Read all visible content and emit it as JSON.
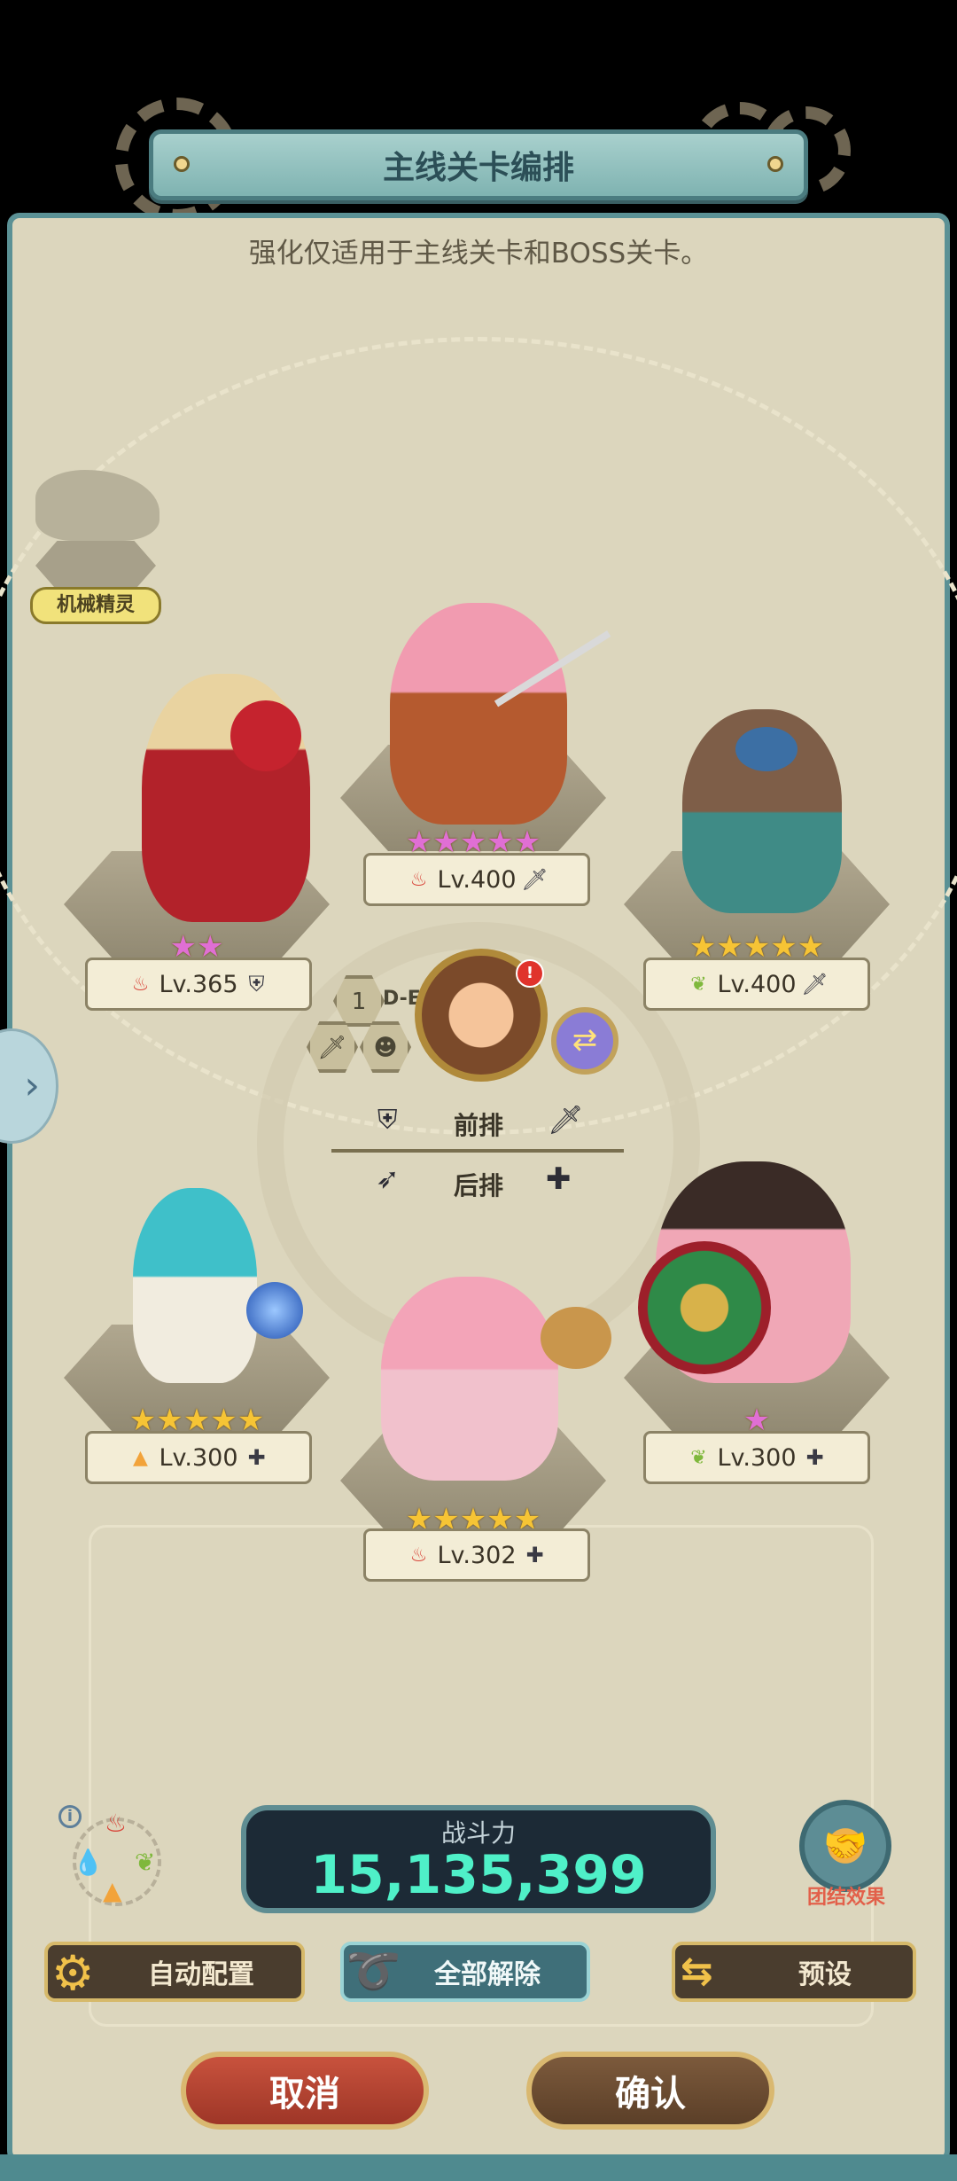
{
  "header": {
    "title": "主线关卡编排",
    "subtitle": "强化仅适用于主线关卡和BOSS关卡。"
  },
  "pet": {
    "label": "机械精灵"
  },
  "heroes": [
    {
      "slot": "front-left",
      "level": "Lv.365",
      "element": "fire",
      "role": "shield-icon",
      "stars": 2,
      "star_color": "pink"
    },
    {
      "slot": "front-center",
      "level": "Lv.400",
      "element": "fire",
      "role": "sword-icon",
      "stars": 5,
      "star_color": "pink"
    },
    {
      "slot": "front-right",
      "level": "Lv.400",
      "element": "wind",
      "role": "sword-icon",
      "stars": 5,
      "star_color": "gold"
    },
    {
      "slot": "back-left",
      "level": "Lv.300",
      "element": "earth",
      "role": "plus-icon",
      "stars": 5,
      "star_color": "gold"
    },
    {
      "slot": "back-center",
      "level": "Lv.302",
      "element": "fire",
      "role": "plus-icon",
      "stars": 5,
      "star_color": "gold"
    },
    {
      "slot": "back-right",
      "level": "Lv.300",
      "element": "wind",
      "role": "plus-icon",
      "stars": 1,
      "star_color": "pink"
    }
  ],
  "formation": {
    "leader_number": "1",
    "leader_tag": "D-E",
    "front_label": "前排",
    "back_label": "后排"
  },
  "power": {
    "label": "战斗力",
    "value": "15,135,399"
  },
  "team_effect": {
    "label": "团结效果"
  },
  "buttons": {
    "auto": "自动配置",
    "clear": "全部解除",
    "preset": "预设",
    "cancel": "取消",
    "confirm": "确认"
  },
  "colors": {
    "fire": "#d8453a",
    "wind": "#7fb83c",
    "earth": "#f2a33a",
    "water": "#3f7ad0",
    "accent_teal": "#5b9195",
    "power_green": "#4ff0c8"
  }
}
